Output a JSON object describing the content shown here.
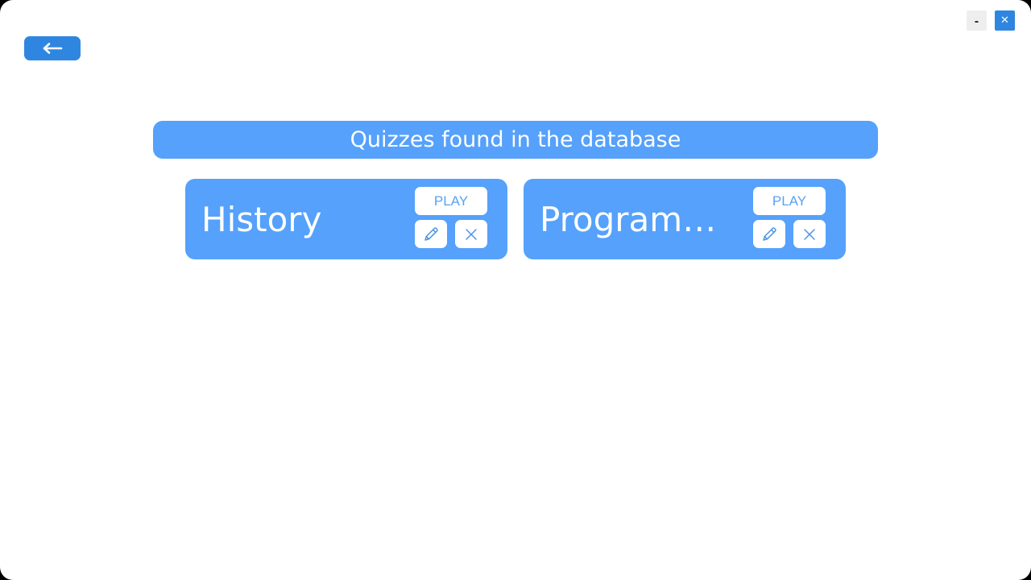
{
  "window": {
    "minimize_label": "-",
    "close_label": "✕"
  },
  "header": {
    "back_icon": "arrow-left-icon",
    "title": "Quizzes found in the database"
  },
  "quizzes": [
    {
      "name": "History",
      "play_label": "PLAY",
      "edit_icon": "pencil-icon",
      "delete_icon": "close-icon"
    },
    {
      "name": "Programmi...",
      "play_label": "PLAY",
      "edit_icon": "pencil-icon",
      "delete_icon": "close-icon"
    }
  ],
  "colors": {
    "accent_dark": "#2f86e0",
    "accent": "#55a1fb",
    "accent_text": "#5aa2f0",
    "background": "#ffffff"
  }
}
